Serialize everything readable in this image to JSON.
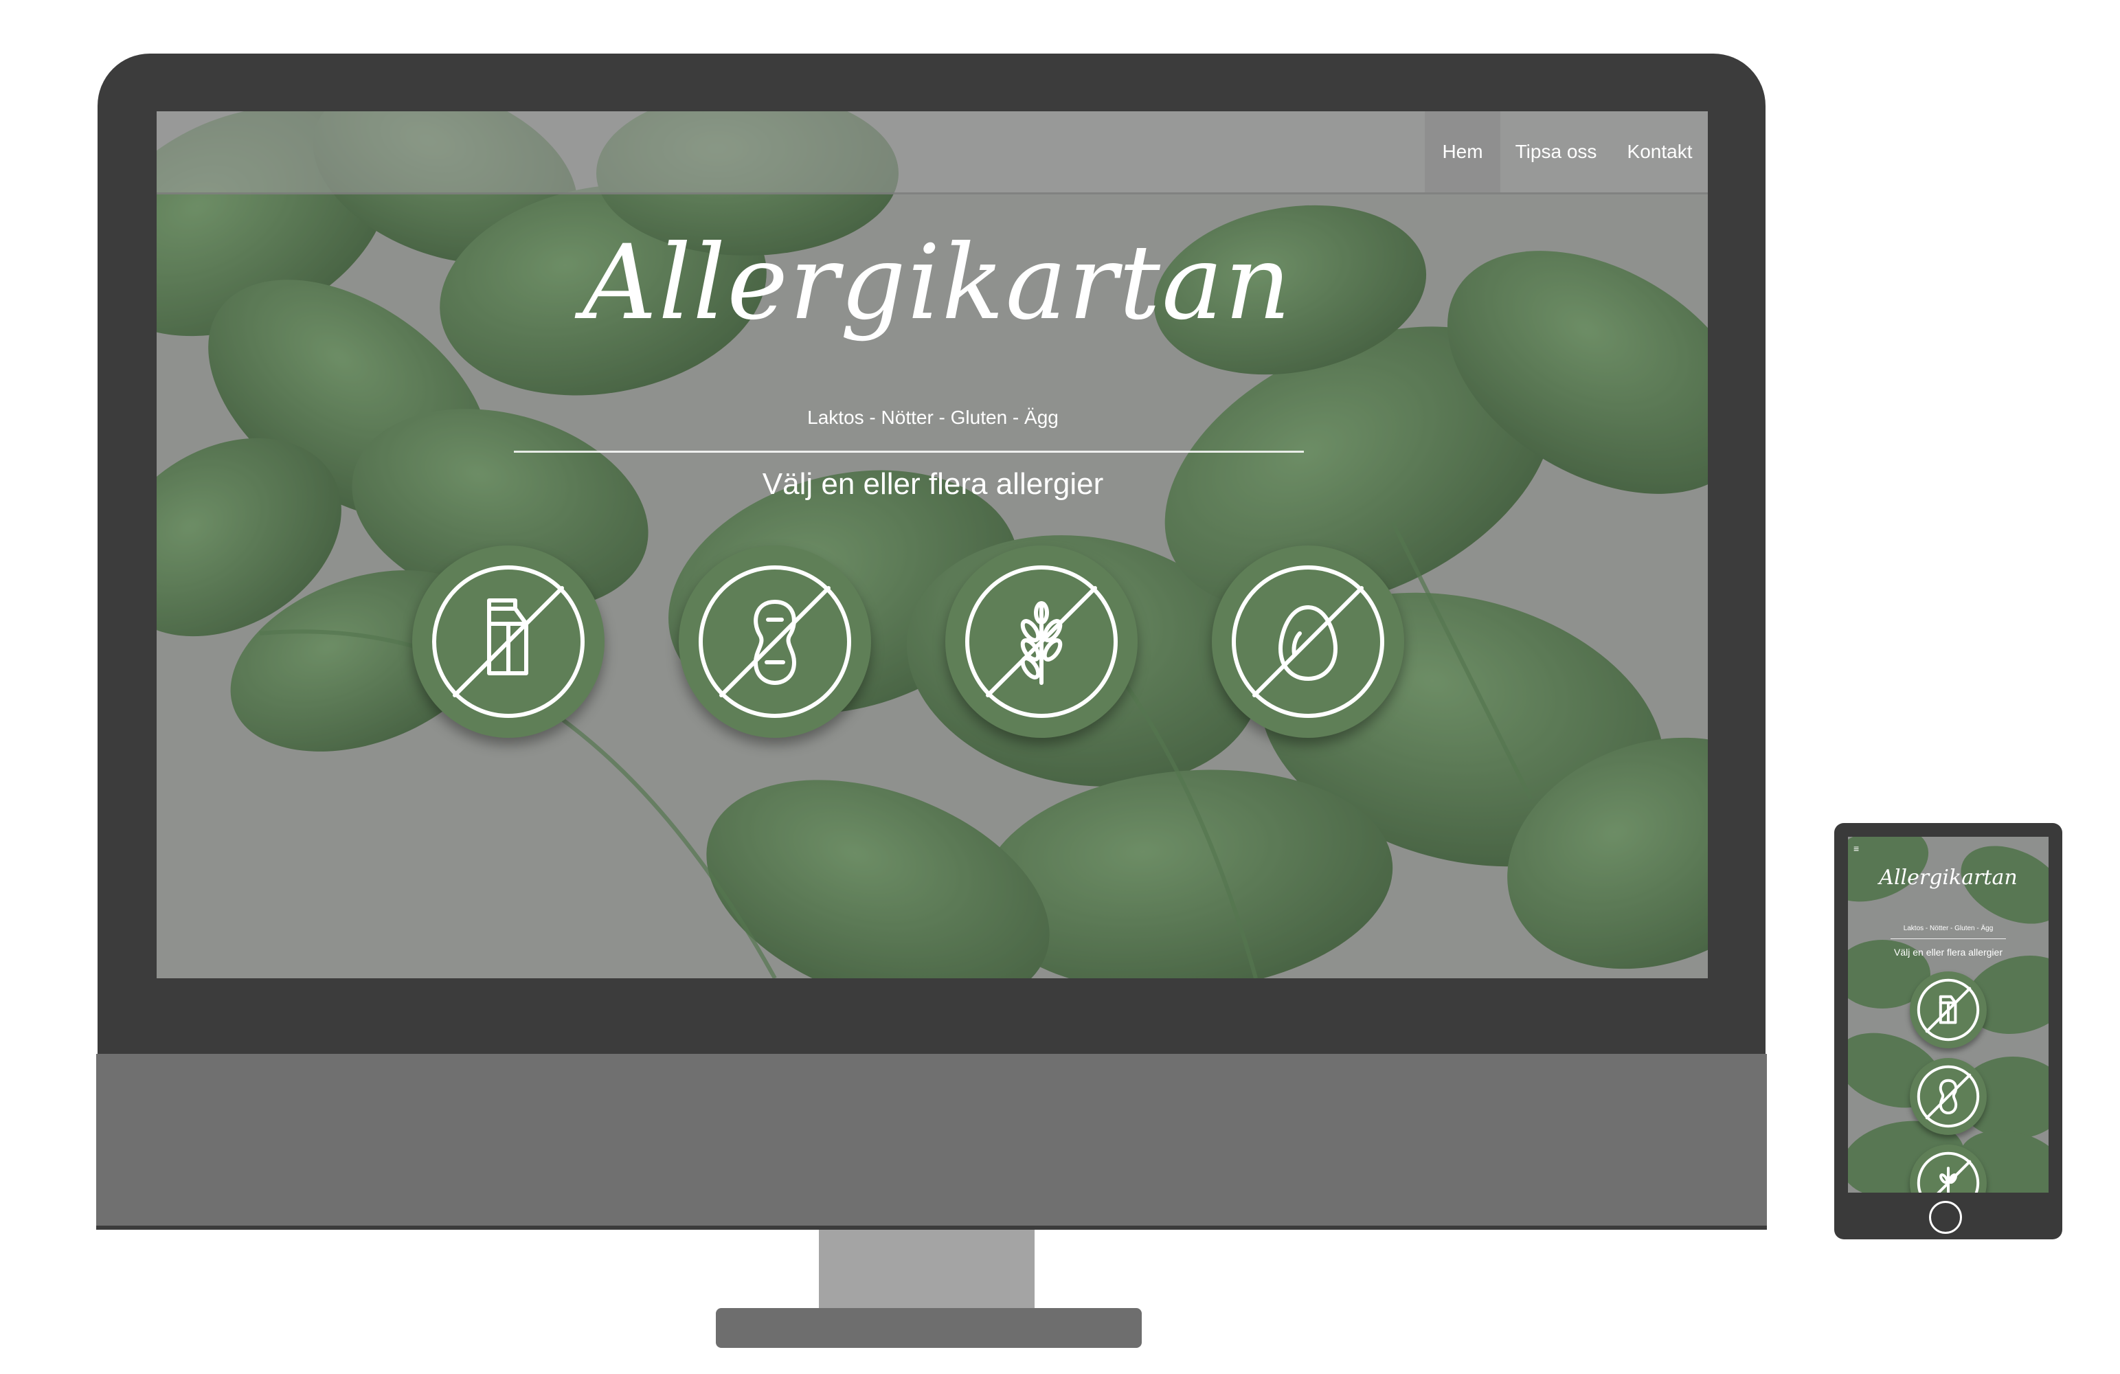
{
  "nav": {
    "items": [
      {
        "label": "Hem",
        "active": true
      },
      {
        "label": "Tipsa oss",
        "active": false
      },
      {
        "label": "Kontakt",
        "active": false
      }
    ]
  },
  "hero": {
    "logo": "Allergikartan",
    "tagline": "Laktos - Nötter - Gluten - Ägg",
    "subtitle": "Välj en eller flera allergier"
  },
  "allergies": [
    {
      "icon": "no-milk-icon"
    },
    {
      "icon": "no-nuts-icon"
    },
    {
      "icon": "no-gluten-icon"
    },
    {
      "icon": "no-egg-icon"
    }
  ],
  "mobile": {
    "menu_icon": "hamburger-icon",
    "menu_glyph": "≡",
    "logo": "Allergikartan",
    "tagline": "Laktos - Nötter - Gluten - Ägg",
    "subtitle": "Välj en eller flera allergier"
  },
  "colors": {
    "accent_green": "#5f7f57",
    "overlay_gray": "#a0a0a0",
    "device_dark": "#3c3c3c"
  }
}
